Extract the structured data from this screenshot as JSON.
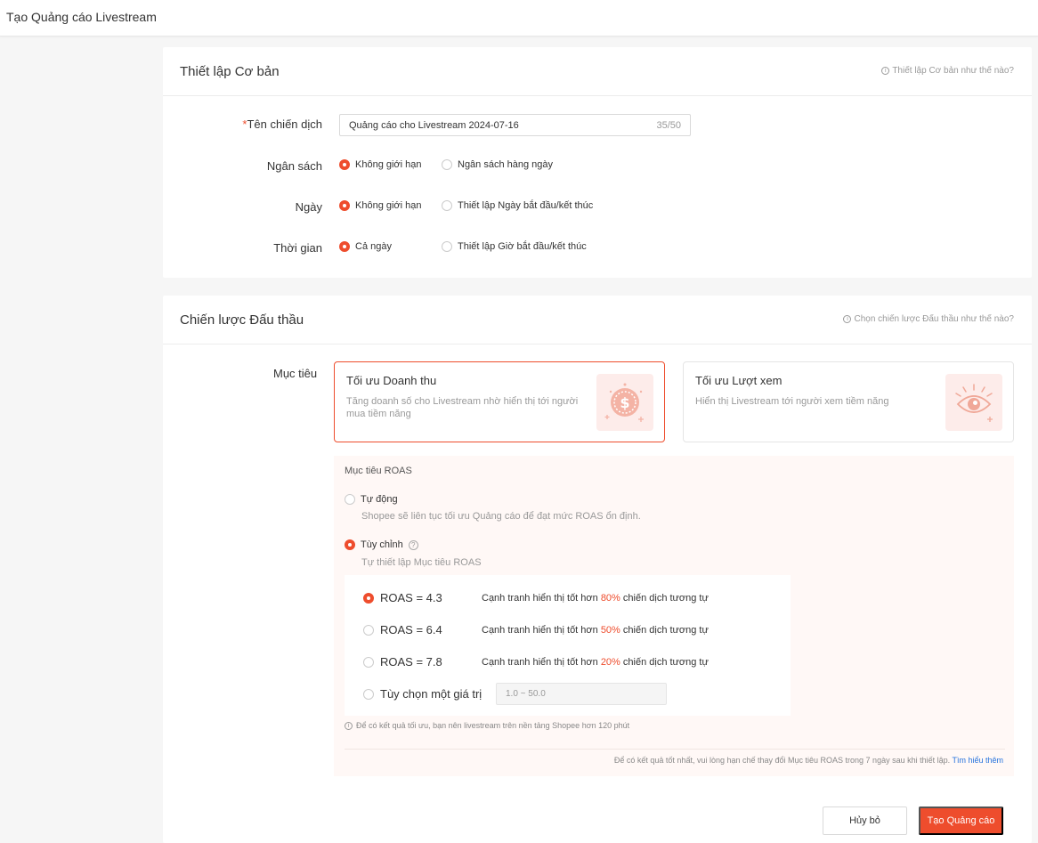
{
  "page": {
    "title": "Tạo Quảng cáo Livestream"
  },
  "basic": {
    "heading": "Thiết lập Cơ bản",
    "help": "Thiết lập Cơ bản như thế nào?",
    "name_required_mark": "*",
    "name_label": "Tên chiến dịch",
    "name_value": "Quảng cáo cho Livestream 2024-07-16",
    "name_count": "35/50",
    "budget_label": "Ngân sách",
    "budget_opt1": "Không giới hạn",
    "budget_opt2": "Ngân sách hàng ngày",
    "date_label": "Ngày",
    "date_opt1": "Không giới hạn",
    "date_opt2": "Thiết lập Ngày bắt đầu/kết thúc",
    "time_label": "Thời gian",
    "time_opt1": "Cả ngày",
    "time_opt2": "Thiết lập Giờ bắt đầu/kết thúc"
  },
  "bidding": {
    "heading": "Chiến lược Đấu thầu",
    "help": "Chọn chiến lược Đấu thầu như thế nào?",
    "goal_label": "Mục tiêu",
    "goal1_title": "Tối ưu Doanh thu",
    "goal1_desc": "Tăng doanh số cho Livestream nhờ hiển thị tới người mua tiềm năng",
    "goal2_title": "Tối ưu Lượt xem",
    "goal2_desc": "Hiển thị Livestream tới người xem tiềm năng",
    "roas_title": "Mục tiêu ROAS",
    "auto_title": "Tự động",
    "auto_desc": "Shopee sẽ liên tục tối ưu Quảng cáo để đạt mức ROAS ổn định.",
    "custom_title": "Tùy chỉnh",
    "custom_desc": "Tự thiết lập Mục tiêu ROAS",
    "options": [
      {
        "label": "ROAS = 4.3",
        "pre": "Cạnh tranh hiển thị tốt hơn ",
        "pct": "80%",
        "post": " chiến dịch tương tự"
      },
      {
        "label": "ROAS = 6.4",
        "pre": "Cạnh tranh hiển thị tốt hơn ",
        "pct": "50%",
        "post": " chiến dịch tương tự"
      },
      {
        "label": "ROAS = 7.8",
        "pre": "Cạnh tranh hiển thị tốt hơn ",
        "pct": "20%",
        "post": " chiến dịch tương tự"
      }
    ],
    "custom_value_label": "Tùy chọn một giá trị",
    "custom_value_placeholder": "1.0 ~ 50.0",
    "tip1": "Để có kết quả tối ưu, bạn nên livestream trên nền tảng Shopee hơn 120 phút",
    "tip2": "Để có kết quả tốt nhất, vui lòng hạn chế thay đổi Mục tiêu ROAS trong 7 ngày sau khi thiết lập.",
    "learn_more": "Tìm hiểu thêm"
  },
  "actions": {
    "cancel": "Hủy bỏ",
    "create": "Tạo Quảng cáo"
  },
  "colors": {
    "accent": "#ee4d2d",
    "link": "#2673dd"
  },
  "icons": {
    "info": "info-icon",
    "money": "money-coin-icon",
    "eye": "eye-icon"
  }
}
